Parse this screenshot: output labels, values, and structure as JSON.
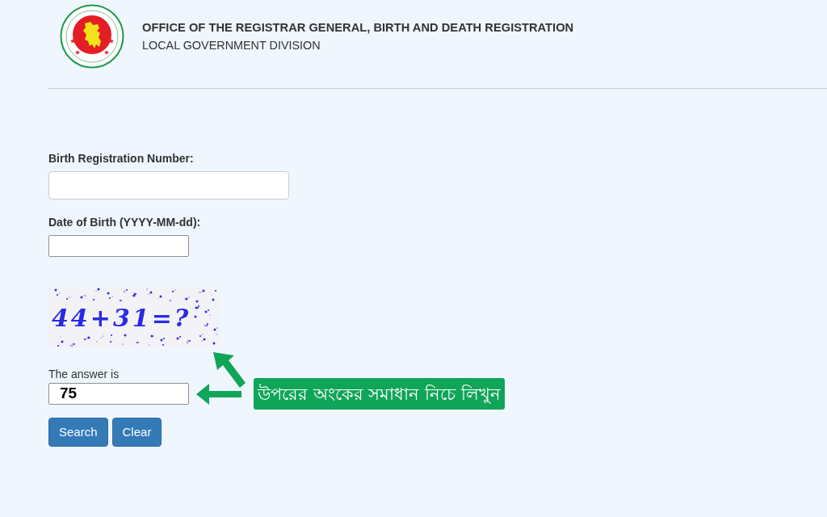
{
  "header": {
    "title": "OFFICE OF THE REGISTRAR GENERAL, BIRTH AND DEATH REGISTRATION",
    "subtitle": "LOCAL GOVERNMENT DIVISION"
  },
  "form": {
    "registration_number": {
      "label": "Birth Registration Number:"
    },
    "date_of_birth": {
      "label": "Date of Birth (YYYY-MM-dd):"
    },
    "captcha": {
      "text": "44+31=?"
    },
    "answer": {
      "label": "The answer is",
      "value": "75"
    },
    "buttons": [
      "Search",
      "Clear"
    ]
  },
  "annotation": {
    "text": "উপরের অংকের সমাধান নিচে লিখুন"
  }
}
